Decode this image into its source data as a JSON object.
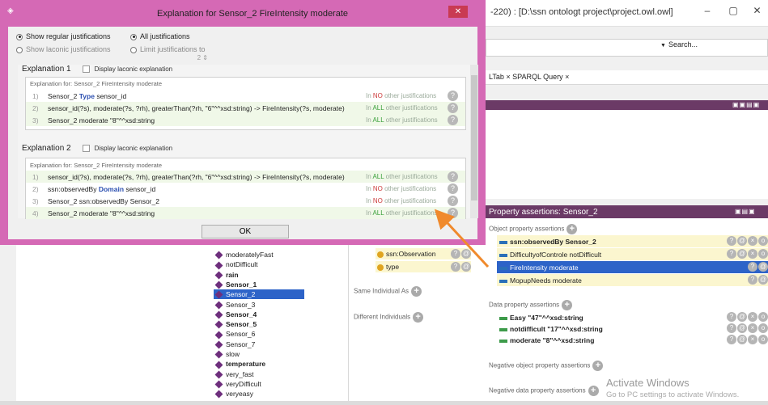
{
  "main_window": {
    "title": "-220)  : [D:\\ssn ontologt project\\project.owl.owl]",
    "minimize": "–",
    "maximize": "▢",
    "close": "✕"
  },
  "search": {
    "label": "Search..."
  },
  "tabs_text": "LTab × SPARQL Query ×",
  "upper_panel_icons": "▣▣▤▣",
  "property_panel": {
    "title": "Property assertions: Sensor_2",
    "icons": "▣▤▣",
    "object_section": "Object property assertions",
    "object_rows": [
      {
        "label": "ssn:observedBy  Sensor_2",
        "bold": true,
        "style": "yellow"
      },
      {
        "label": "DifficultyofControle  notDifficult",
        "bold": false,
        "style": "yellow"
      },
      {
        "label": "FireIntensity  moderate",
        "bold": false,
        "style": "selected"
      },
      {
        "label": "MopupNeeds  moderate",
        "bold": false,
        "style": "yellow"
      }
    ],
    "data_section": "Data property assertions",
    "data_rows": [
      {
        "label": "Easy  \"47\"^^xsd:string"
      },
      {
        "label": "notdifficult  \"17\"^^xsd:string"
      },
      {
        "label": "moderate  \"8\"^^xsd:string"
      }
    ],
    "neg_object_section": "Negative object property assertions",
    "neg_data_section": "Negative data property assertions"
  },
  "watermark": {
    "line1": "Activate Windows",
    "line2": "Go to PC settings to activate Windows."
  },
  "types_panel": {
    "rows": [
      {
        "label": "ssn:Observation"
      },
      {
        "label": "type"
      }
    ],
    "same_individual": "Same Individual As",
    "different_individuals": "Different Individuals"
  },
  "individuals": [
    {
      "label": "moderatelyFast",
      "bold": false
    },
    {
      "label": "notDifficult",
      "bold": false
    },
    {
      "label": "rain",
      "bold": true
    },
    {
      "label": "Sensor_1",
      "bold": true
    },
    {
      "label": "Sensor_2",
      "bold": false,
      "selected": true
    },
    {
      "label": "Sensor_3",
      "bold": false
    },
    {
      "label": "Sensor_4",
      "bold": true
    },
    {
      "label": "Sensor_5",
      "bold": true
    },
    {
      "label": "Sensor_6",
      "bold": false
    },
    {
      "label": "Sensor_7",
      "bold": false
    },
    {
      "label": "slow",
      "bold": false
    },
    {
      "label": "temperature",
      "bold": true
    },
    {
      "label": "very_fast",
      "bold": false
    },
    {
      "label": "veryDifficult",
      "bold": false
    },
    {
      "label": "veryeasy",
      "bold": false
    }
  ],
  "dialog": {
    "title": "Explanation for Sensor_2 FireIntensity moderate",
    "close": "✕",
    "radio_regular": "Show regular justifications",
    "radio_all": "All justifications",
    "radio_laconic": "Show laconic justifications",
    "radio_limit": "Limit justifications to",
    "limit_value": "2",
    "ok": "OK"
  },
  "explanations": [
    {
      "heading": "Explanation 1",
      "laconic": "Display laconic explanation",
      "for_text": "Explanation for: Sensor_2 FireIntensity moderate",
      "axioms": [
        {
          "num": "1)",
          "pre": "Sensor_2 ",
          "kw": "Type",
          "post": " sensor_id",
          "quant": "NO",
          "suffix": " other justifications",
          "green": false
        },
        {
          "num": "2)",
          "pre": "sensor_id(?s), moderate(?s, ?rh), greaterThan(?rh, \"6\"^^xsd:string) -> FireIntensity(?s, moderate)",
          "kw": "",
          "post": "",
          "quant": "ALL",
          "suffix": " other justifications",
          "green": true
        },
        {
          "num": "3)",
          "pre": "Sensor_2 moderate \"8\"^^xsd:string",
          "kw": "",
          "post": "",
          "quant": "ALL",
          "suffix": " other justifications",
          "green": true
        }
      ]
    },
    {
      "heading": "Explanation 2",
      "laconic": "Display laconic explanation",
      "for_text": "Explanation for: Sensor_2 FireIntensity moderate",
      "axioms": [
        {
          "num": "1)",
          "pre": "sensor_id(?s), moderate(?s, ?rh), greaterThan(?rh, \"6\"^^xsd:string) -> FireIntensity(?s, moderate)",
          "kw": "",
          "post": "",
          "quant": "ALL",
          "suffix": " other justifications",
          "green": true
        },
        {
          "num": "2)",
          "pre": "ssn:observedBy ",
          "kw": "Domain",
          "post": " sensor_id",
          "quant": "NO",
          "suffix": " other justifications",
          "green": false
        },
        {
          "num": "3)",
          "pre": "Sensor_2 ssn:observedBy Sensor_2",
          "kw": "",
          "post": "",
          "quant": "NO",
          "suffix": " other justifications",
          "green": false
        },
        {
          "num": "4)",
          "pre": "Sensor_2 moderate \"8\"^^xsd:string",
          "kw": "",
          "post": "",
          "quant": "ALL",
          "suffix": " other justifications",
          "green": true
        }
      ]
    }
  ],
  "colors": {
    "dialog_frame": "#d569b5",
    "panel_header": "#6b3a66",
    "selection": "#2d63c8",
    "arrow": "#f08a2c"
  }
}
